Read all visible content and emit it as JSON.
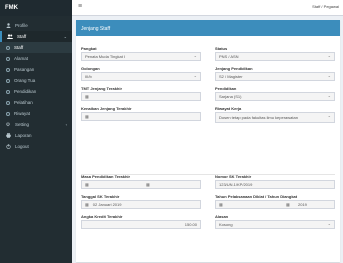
{
  "brand": "FMK",
  "sidebar": {
    "items": [
      {
        "label": "Profile",
        "icon": "user-icon"
      },
      {
        "label": "Staff",
        "icon": "users-icon"
      },
      {
        "label": "Staff",
        "icon": "circle-icon"
      },
      {
        "label": "Alamat",
        "icon": "circle-icon"
      },
      {
        "label": "Pasangan",
        "icon": "circle-icon"
      },
      {
        "label": "Orang Tua",
        "icon": "circle-icon"
      },
      {
        "label": "Pendidikan",
        "icon": "circle-icon"
      },
      {
        "label": "Pelatihan",
        "icon": "circle-icon"
      },
      {
        "label": "Riwayat",
        "icon": "circle-icon"
      },
      {
        "label": "Setting",
        "icon": "gear-icon"
      },
      {
        "label": "Laporan",
        "icon": "print-icon"
      },
      {
        "label": "Logout",
        "icon": "logout-icon"
      }
    ]
  },
  "topbar": {
    "user": "Staff / Pegawai"
  },
  "panel": {
    "title": "Jenjang Staff"
  },
  "form": {
    "pangkat": {
      "label": "Pangkat",
      "value": "Penata Muda Tingkat I"
    },
    "status": {
      "label": "Status",
      "value": "PNS / ASN"
    },
    "golongan": {
      "label": "Golongan",
      "value": "III/b"
    },
    "jenjang": {
      "label": "Jenjang Pendidikan",
      "value": "S2 / Magister"
    },
    "tmt_jenjang": {
      "label": "TMT Jenjang Terakhir",
      "value": ""
    },
    "pendidikan": {
      "label": "Pendidikan",
      "value": "Sarjana (S1)"
    },
    "kenaikan": {
      "label": "Kenaikan Jenjang Terakhir",
      "value": ""
    },
    "riwayat": {
      "label": "Riwayat Kerja",
      "value": "Dosen tetap pada fakultas ilmu keperawatan"
    },
    "masa_kerja": {
      "label": "Masa Pendidikan Terakhir",
      "value": ""
    },
    "nomor_sk": {
      "label": "Nomor SK Terakhir",
      "value": "123/UN.1/KP/2019"
    },
    "tanggal_sk": {
      "label": "Tanggal SK Terakhir",
      "value": "02 Januari 2019"
    },
    "tahun": {
      "label": "Tahun Pelaksanaan Diklat / Tahun Diangkat",
      "value": "2019"
    },
    "angka": {
      "label": "Angka Kredit Terakhir",
      "value": "150.00"
    },
    "alasan": {
      "label": "Alasan",
      "value": "Kosong"
    }
  }
}
